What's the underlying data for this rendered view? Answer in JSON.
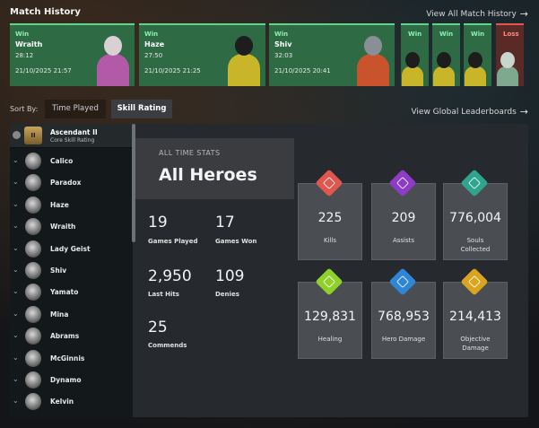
{
  "header": {
    "title": "Match History",
    "view_all": "View All Match History",
    "arrow": "→"
  },
  "matches": [
    {
      "result": "Win",
      "hero": "Wraith",
      "duration": "28:12",
      "date": "21/10/2025 21:57"
    },
    {
      "result": "Win",
      "hero": "Haze",
      "duration": "27:50",
      "date": "21/10/2025 21:25"
    },
    {
      "result": "Win",
      "hero": "Shiv",
      "duration": "32:03",
      "date": "21/10/2025 20:41"
    }
  ],
  "mini_matches": [
    {
      "result": "Win"
    },
    {
      "result": "Win"
    },
    {
      "result": "Win"
    },
    {
      "result": "Loss"
    }
  ],
  "sort": {
    "label": "Sort By:",
    "options": [
      "Time Played",
      "Skill Rating"
    ],
    "selected": "Skill Rating",
    "global": "View Global Leaderboards"
  },
  "rank": {
    "badge_text": "II",
    "name": "Ascendant II",
    "subtitle": "Core Skill Rating"
  },
  "heroes": [
    "Calico",
    "Paradox",
    "Haze",
    "Wraith",
    "Lady Geist",
    "Shiv",
    "Yamato",
    "Mina",
    "Abrams",
    "McGinnis",
    "Dynamo",
    "Kelvin"
  ],
  "hero_chevron": "⌄",
  "stats": {
    "section_label": "ALL TIME STATS",
    "title": "All Heroes",
    "games_played": {
      "value": "19",
      "label": "Games Played"
    },
    "games_won": {
      "value": "17",
      "label": "Games Won"
    },
    "last_hits": {
      "value": "2,950",
      "label": "Last Hits"
    },
    "denies": {
      "value": "109",
      "label": "Denies"
    },
    "commends": {
      "value": "25",
      "label": "Commends"
    }
  },
  "tiles": [
    {
      "value": "225",
      "label": "Kills",
      "color": "#e0574f",
      "icon": "target-icon"
    },
    {
      "value": "209",
      "label": "Assists",
      "color": "#8e3cc7",
      "icon": "handshake-icon"
    },
    {
      "value": "776,004",
      "label": "Souls\nCollected",
      "color": "#2fa58f",
      "icon": "soul-icon"
    },
    {
      "value": "129,831",
      "label": "Healing",
      "color": "#8fd12a",
      "icon": "plus-icon"
    },
    {
      "value": "768,953",
      "label": "Hero Damage",
      "color": "#2f86d6",
      "icon": "crossed-swords-icon"
    },
    {
      "value": "214,413",
      "label": "Objective\nDamage",
      "color": "#d9a520",
      "icon": "tower-icon"
    }
  ]
}
